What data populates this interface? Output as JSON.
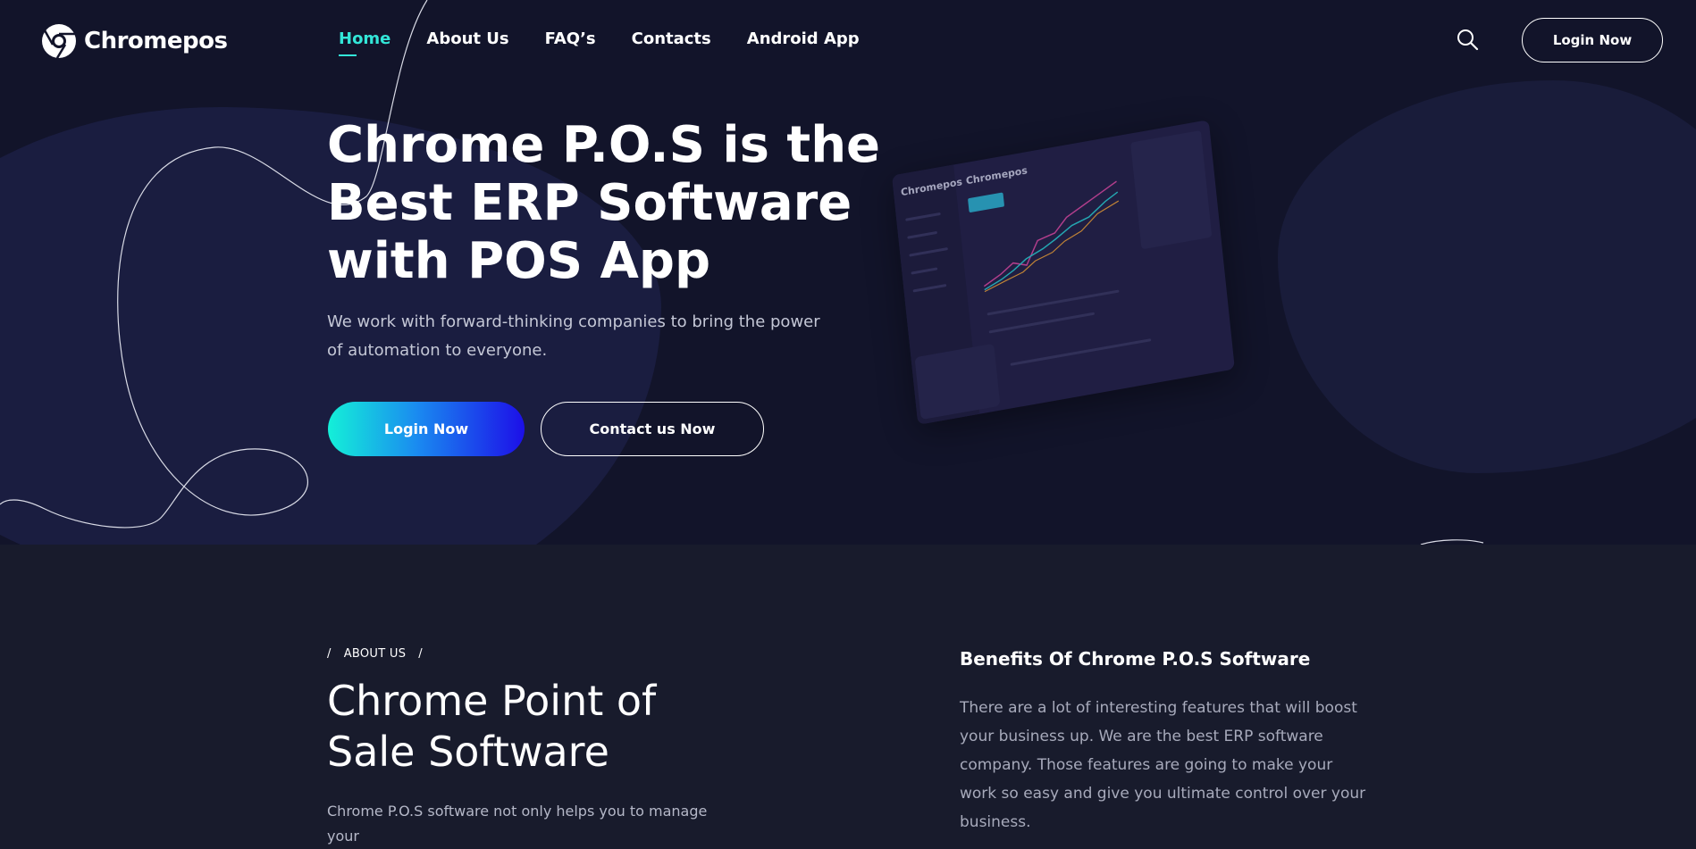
{
  "brand": {
    "name": "Chromepos",
    "logo_icon": "chrome-logo-icon"
  },
  "nav": {
    "items": [
      {
        "label": "Home",
        "active": true
      },
      {
        "label": "About Us",
        "active": false
      },
      {
        "label": "FAQ’s",
        "active": false
      },
      {
        "label": "Contacts",
        "active": false
      },
      {
        "label": "Android App",
        "active": false
      }
    ],
    "search_icon": "search-icon",
    "login_label": "Login Now"
  },
  "hero": {
    "title_lines": [
      "Chrome P.O.S is the",
      "Best ERP Software",
      "with POS App"
    ],
    "subtitle": "We work with forward-thinking companies to bring the power of automation to everyone.",
    "primary_cta": "Login Now",
    "secondary_cta": "Contact us Now",
    "mockup": {
      "logo": "Chromepos"
    }
  },
  "about": {
    "eyebrow": "ABOUT US",
    "eyebrow_sep": "/",
    "title_lines": [
      "Chrome Point of",
      "Sale Software"
    ],
    "text": "Chrome P.O.S software not only helps you to manage your",
    "benefits_title": "Benefits Of Chrome P.O.S Software",
    "benefits_text": "There are a lot of interesting features that will boost your business up. We are the best ERP software company. Those features are going to make your work so easy and give you ultimate control over your business."
  },
  "colors": {
    "hero_bg": "#12142a",
    "section_bg": "#181b2c",
    "accent": "#33e6d8",
    "gradient_start": "#14f0d8",
    "gradient_end": "#1c0fe8"
  }
}
